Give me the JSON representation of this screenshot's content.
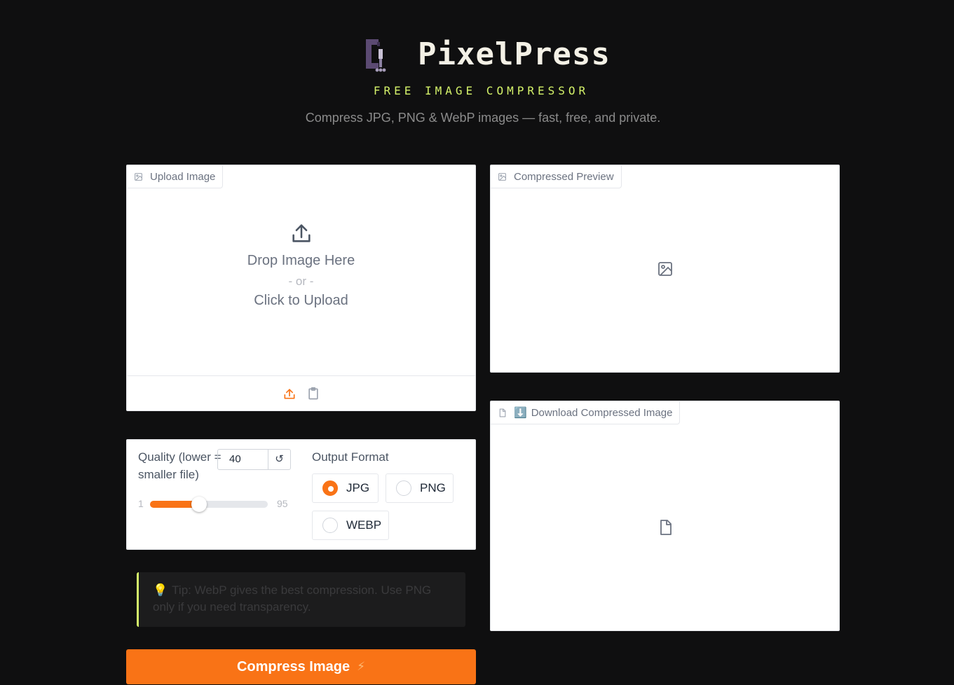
{
  "header": {
    "brand": "PixelPress",
    "tagline": "FREE IMAGE COMPRESSOR",
    "subtitle": "Compress JPG, PNG & WebP images — fast, free, and private."
  },
  "upload": {
    "tab_label": "Upload Image",
    "drop_text": "Drop Image Here",
    "or_text": "- or -",
    "click_text": "Click to Upload"
  },
  "preview": {
    "tab_label": "Compressed Preview"
  },
  "download": {
    "tab_emoji": "⬇️",
    "tab_label": "Download Compressed Image"
  },
  "quality": {
    "label": "Quality (lower = smaller file)",
    "value": "40",
    "reset_icon": "↺",
    "min": "1",
    "max": "95",
    "slider_min": 1,
    "slider_max": 95,
    "slider_value": 40
  },
  "format": {
    "label": "Output Format",
    "options": [
      "JPG",
      "PNG",
      "WEBP"
    ],
    "selected": "JPG"
  },
  "tip": {
    "emoji": "💡",
    "text": "Tip: WebP gives the best compression. Use PNG only if you need transparency."
  },
  "compress_button": {
    "label": "Compress Image",
    "icon": "⚡"
  },
  "colors": {
    "accent": "#f97316",
    "highlight": "#d4f26a",
    "background": "#0f0f10"
  }
}
